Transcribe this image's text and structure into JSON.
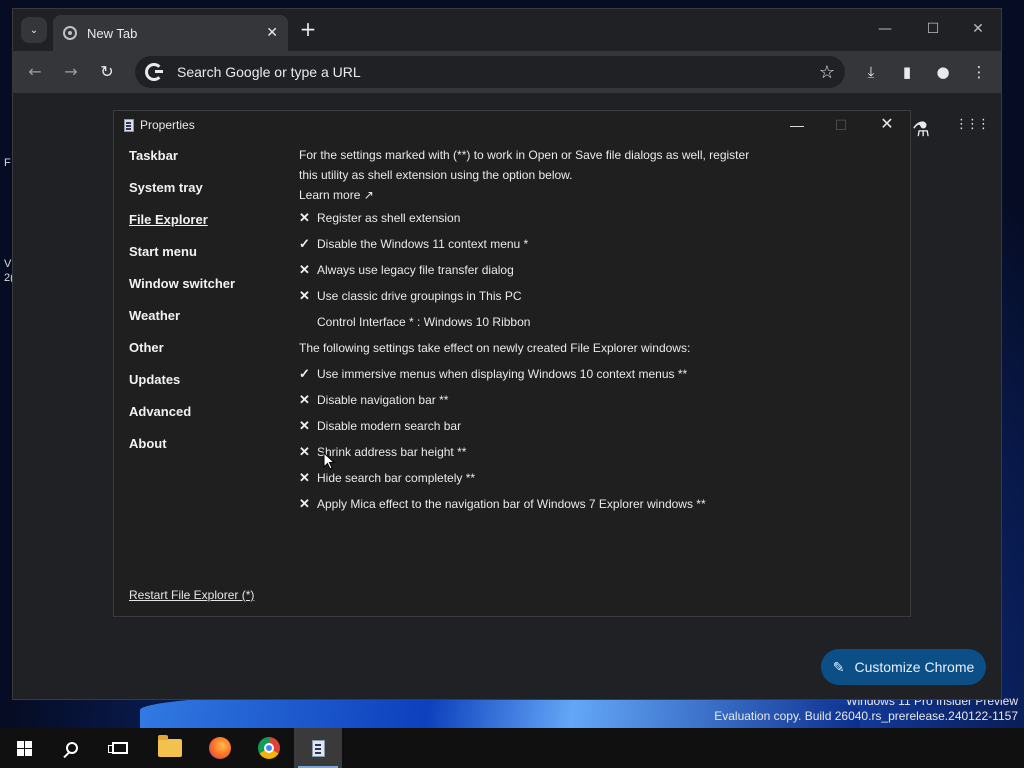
{
  "desktop": {
    "edge_chars": [
      "F",
      "V",
      "2("
    ],
    "watermark": {
      "line1": "Windows 11 Pro Insider Preview",
      "line2": "Evaluation copy. Build 26040.rs_prerelease.240122-1157"
    }
  },
  "chrome": {
    "tab_search_icon": "chevron-down-icon",
    "tab": {
      "title": "New Tab",
      "close_icon": "close-icon"
    },
    "new_tab_icon": "plus-icon",
    "omnibox": {
      "placeholder": "Search Google or type a URL"
    },
    "customize_label": "Customize Chrome",
    "icons": {
      "back": "←",
      "forward": "→",
      "reload": "↻",
      "star": "☆",
      "download": "⤓",
      "side_panel": "▮",
      "profile": "●",
      "menu": "⋮",
      "labs": "⚗",
      "apps": "⋮⋮⋮",
      "minimize": "—",
      "maximize": "☐",
      "close": "✕",
      "pencil": "✎",
      "chevron": "⌄",
      "tab_close": "✕",
      "plus": "+"
    }
  },
  "properties": {
    "title": "Properties",
    "controls": {
      "minimize": "—",
      "maximize": "☐",
      "close": "✕"
    },
    "nav": [
      {
        "label": "Taskbar",
        "active": false
      },
      {
        "label": "System tray",
        "active": false
      },
      {
        "label": "File Explorer",
        "active": true
      },
      {
        "label": "Start menu",
        "active": false
      },
      {
        "label": "Window switcher",
        "active": false
      },
      {
        "label": "Weather",
        "active": false
      },
      {
        "label": "Other",
        "active": false
      },
      {
        "label": "Updates",
        "active": false
      },
      {
        "label": "Advanced",
        "active": false
      },
      {
        "label": "About",
        "active": false
      }
    ],
    "restart_link": "Restart File Explorer (*)",
    "intro": "For the settings marked with (**) to work in Open or Save file dialogs as well, register this utility as shell extension using the option below.",
    "learn_more": "Learn more ↗",
    "options_group1": [
      {
        "mark": "✕",
        "label": "Register as shell extension"
      },
      {
        "mark": "✓",
        "label": "Disable the Windows 11 context menu *"
      },
      {
        "mark": "✕",
        "label": "Always use legacy file transfer dialog"
      },
      {
        "mark": "✕",
        "label": "Use classic drive groupings in This PC"
      },
      {
        "mark": "",
        "label": "Control Interface * : Windows 10 Ribbon"
      }
    ],
    "section2_head": "The following settings take effect on newly created File Explorer windows:",
    "options_group2": [
      {
        "mark": "✓",
        "label": "Use immersive menus when displaying Windows 10 context menus **"
      },
      {
        "mark": "✕",
        "label": "Disable navigation bar **"
      },
      {
        "mark": "✕",
        "label": "Disable modern search bar"
      },
      {
        "mark": "✕",
        "label": "Shrink address bar height **"
      },
      {
        "mark": "✕",
        "label": "Hide search bar completely **"
      },
      {
        "mark": "✕",
        "label": "Apply Mica effect to the navigation bar of Windows 7 Explorer windows **"
      }
    ]
  },
  "taskbar": {
    "items": [
      {
        "name": "start-button",
        "icon": "windows-start-icon"
      },
      {
        "name": "search-button",
        "icon": "search-icon"
      },
      {
        "name": "task-view-button",
        "icon": "task-view-icon"
      },
      {
        "name": "file-explorer-button",
        "icon": "folder-icon"
      },
      {
        "name": "firefox-button",
        "icon": "firefox-icon"
      },
      {
        "name": "chrome-button",
        "icon": "chrome-icon"
      },
      {
        "name": "properties-app-button",
        "icon": "properties-app-icon",
        "active": true
      }
    ]
  }
}
